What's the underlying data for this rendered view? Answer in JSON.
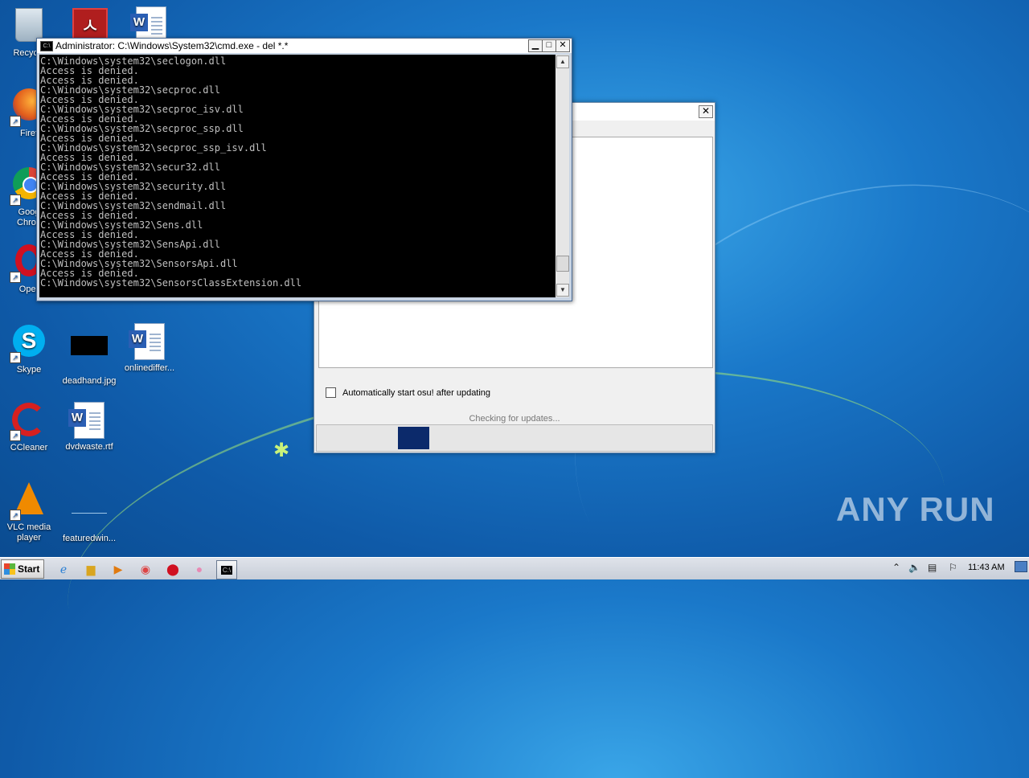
{
  "desktop_icons": [
    {
      "label": "Recycle",
      "icon": "recycle-bin-icon"
    },
    {
      "label": "",
      "icon": "adobe-reader-icon"
    },
    {
      "label": "",
      "icon": "word-document-icon"
    },
    {
      "label": "Firef",
      "icon": "firefox-icon"
    },
    {
      "label": "Goog Chron",
      "icon": "chrome-icon"
    },
    {
      "label": "Oper",
      "icon": "opera-icon"
    },
    {
      "label": "Skype",
      "icon": "skype-icon"
    },
    {
      "label": "deadhand.jpg",
      "icon": "image-file-icon"
    },
    {
      "label": "onlinediffer...",
      "icon": "word-document-icon"
    },
    {
      "label": "CCleaner",
      "icon": "ccleaner-icon"
    },
    {
      "label": "dvdwaste.rtf",
      "icon": "word-document-icon"
    },
    {
      "label": "VLC media player",
      "icon": "vlc-icon"
    },
    {
      "label": "featuredwin...",
      "icon": "file-icon"
    }
  ],
  "cmd_window": {
    "title": "Administrator: C:\\Windows\\System32\\cmd.exe - del  *.*",
    "lines": [
      "C:\\Windows\\system32\\seclogon.dll",
      "Access is denied.",
      "Access is denied.",
      "C:\\Windows\\system32\\secproc.dll",
      "Access is denied.",
      "C:\\Windows\\system32\\secproc_isv.dll",
      "Access is denied.",
      "C:\\Windows\\system32\\secproc_ssp.dll",
      "Access is denied.",
      "C:\\Windows\\system32\\secproc_ssp_isv.dll",
      "Access is denied.",
      "C:\\Windows\\system32\\secur32.dll",
      "Access is denied.",
      "C:\\Windows\\system32\\security.dll",
      "Access is denied.",
      "C:\\Windows\\system32\\sendmail.dll",
      "Access is denied.",
      "C:\\Windows\\system32\\Sens.dll",
      "Access is denied.",
      "C:\\Windows\\system32\\SensApi.dll",
      "Access is denied.",
      "C:\\Windows\\system32\\SensorsApi.dll",
      "Access is denied.",
      "C:\\Windows\\system32\\SensorsClassExtension.dll"
    ],
    "scroll_position": 0.93
  },
  "updater_window": {
    "checkbox_label": "Automatically start osu! after updating",
    "checkbox_checked": false,
    "status_text": "Checking for updates...",
    "progress_start": 0.205,
    "progress_width": 0.08
  },
  "taskbar": {
    "start_label": "Start",
    "pinned": [
      "internet-explorer-icon",
      "explorer-folder-icon",
      "media-player-icon",
      "chrome-icon",
      "opera-icon",
      "osu-icon",
      "cmd-icon"
    ],
    "clock": "11:43 AM"
  },
  "watermark": "ANY RUN",
  "colors": {
    "progress_fill": "#0c2a6b",
    "console_bg": "#000000",
    "console_text": "#c0c0c0"
  }
}
